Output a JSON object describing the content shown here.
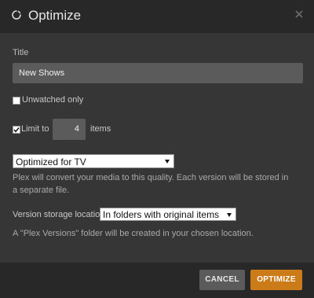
{
  "dialog": {
    "title": "Optimize",
    "icons": {
      "loading": "spinner-icon",
      "close": "close-icon"
    }
  },
  "form": {
    "title_label": "Title",
    "title_value": "New Shows",
    "unwatched_label": "Unwatched only",
    "unwatched_checked": false,
    "limit_label": "Limit to",
    "limit_checked": true,
    "limit_value": "4",
    "limit_suffix": "items",
    "quality_selected": "Optimized for TV",
    "quality_help": "Plex will convert your media to this quality. Each version will be stored in a separate file.",
    "location_label": "Version storage location",
    "location_selected": "In folders with original items",
    "location_help": "A \"Plex Versions\" folder will be created in your chosen location."
  },
  "footer": {
    "cancel_label": "CANCEL",
    "optimize_label": "OPTIMIZE"
  },
  "colors": {
    "accent": "#cc7b19",
    "header_bg": "#282828",
    "body_bg": "#363636",
    "input_bg": "#5b5b5b"
  }
}
